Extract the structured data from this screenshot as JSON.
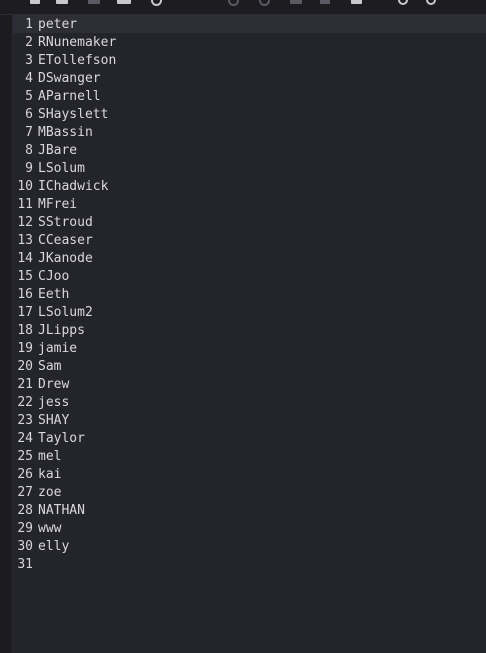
{
  "colors": {
    "background": "#23232a",
    "gutter_text": "#d6d6d8",
    "text": "#d9d9dc",
    "current_line": "#2e2e36"
  },
  "toolbar": {
    "icons": [
      "new-file-icon",
      "open-file-icon",
      "save-icon",
      "save-as-icon",
      "refresh-icon",
      "undo-icon",
      "redo-icon",
      "cut-icon",
      "copy-icon",
      "paste-icon",
      "search-icon",
      "replace-icon"
    ]
  },
  "editor": {
    "lines": [
      {
        "number": "1",
        "text": "peter"
      },
      {
        "number": "2",
        "text": "RNunemaker"
      },
      {
        "number": "3",
        "text": "ETollefson"
      },
      {
        "number": "4",
        "text": "DSwanger"
      },
      {
        "number": "5",
        "text": "AParnell"
      },
      {
        "number": "6",
        "text": "SHayslett"
      },
      {
        "number": "7",
        "text": "MBassin"
      },
      {
        "number": "8",
        "text": "JBare"
      },
      {
        "number": "9",
        "text": "LSolum"
      },
      {
        "number": "10",
        "text": "IChadwick"
      },
      {
        "number": "11",
        "text": "MFrei"
      },
      {
        "number": "12",
        "text": "SStroud"
      },
      {
        "number": "13",
        "text": "CCeaser"
      },
      {
        "number": "14",
        "text": "JKanode"
      },
      {
        "number": "15",
        "text": "CJoo"
      },
      {
        "number": "16",
        "text": "Eeth"
      },
      {
        "number": "17",
        "text": "LSolum2"
      },
      {
        "number": "18",
        "text": "JLipps"
      },
      {
        "number": "19",
        "text": "jamie"
      },
      {
        "number": "20",
        "text": "Sam"
      },
      {
        "number": "21",
        "text": "Drew"
      },
      {
        "number": "22",
        "text": "jess"
      },
      {
        "number": "23",
        "text": "SHAY"
      },
      {
        "number": "24",
        "text": "Taylor"
      },
      {
        "number": "25",
        "text": "mel"
      },
      {
        "number": "26",
        "text": "kai"
      },
      {
        "number": "27",
        "text": "zoe"
      },
      {
        "number": "28",
        "text": "NATHAN"
      },
      {
        "number": "29",
        "text": "www"
      },
      {
        "number": "30",
        "text": "elly"
      },
      {
        "number": "31",
        "text": ""
      }
    ]
  }
}
